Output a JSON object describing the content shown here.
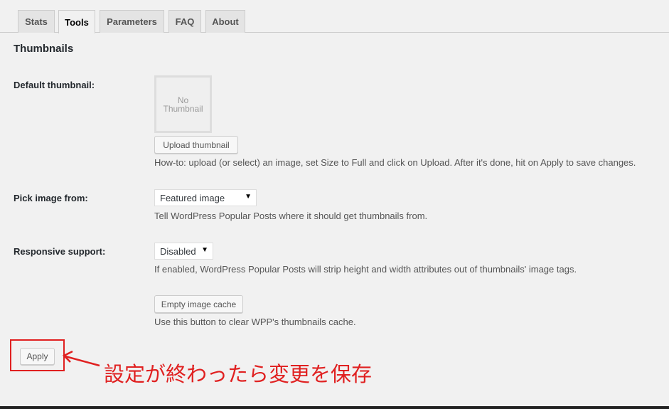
{
  "tabs": [
    {
      "label": "Stats"
    },
    {
      "label": "Tools"
    },
    {
      "label": "Parameters"
    },
    {
      "label": "FAQ"
    },
    {
      "label": "About"
    }
  ],
  "active_tab": "Tools",
  "section_title": "Thumbnails",
  "default_thumbnail": {
    "label": "Default thumbnail:",
    "placeholder_line1": "No",
    "placeholder_line2": "Thumbnail",
    "upload_button": "Upload thumbnail",
    "help": "How-to: upload (or select) an image, set Size to Full and click on Upload. After it's done, hit on Apply to save changes."
  },
  "pick_image": {
    "label": "Pick image from:",
    "selected": "Featured image",
    "help": "Tell WordPress Popular Posts where it should get thumbnails from."
  },
  "responsive": {
    "label": "Responsive support:",
    "selected": "Disabled",
    "help": "If enabled, WordPress Popular Posts will strip height and width attributes out of thumbnails' image tags."
  },
  "cache": {
    "button": "Empty image cache",
    "help": "Use this button to clear WPP's thumbnails cache."
  },
  "apply_button": "Apply",
  "annotation_text": "設定が終わったら変更を保存",
  "colors": {
    "background": "#f1f1f1",
    "annotation": "#e02020",
    "tab_inactive": "#e4e4e4"
  }
}
